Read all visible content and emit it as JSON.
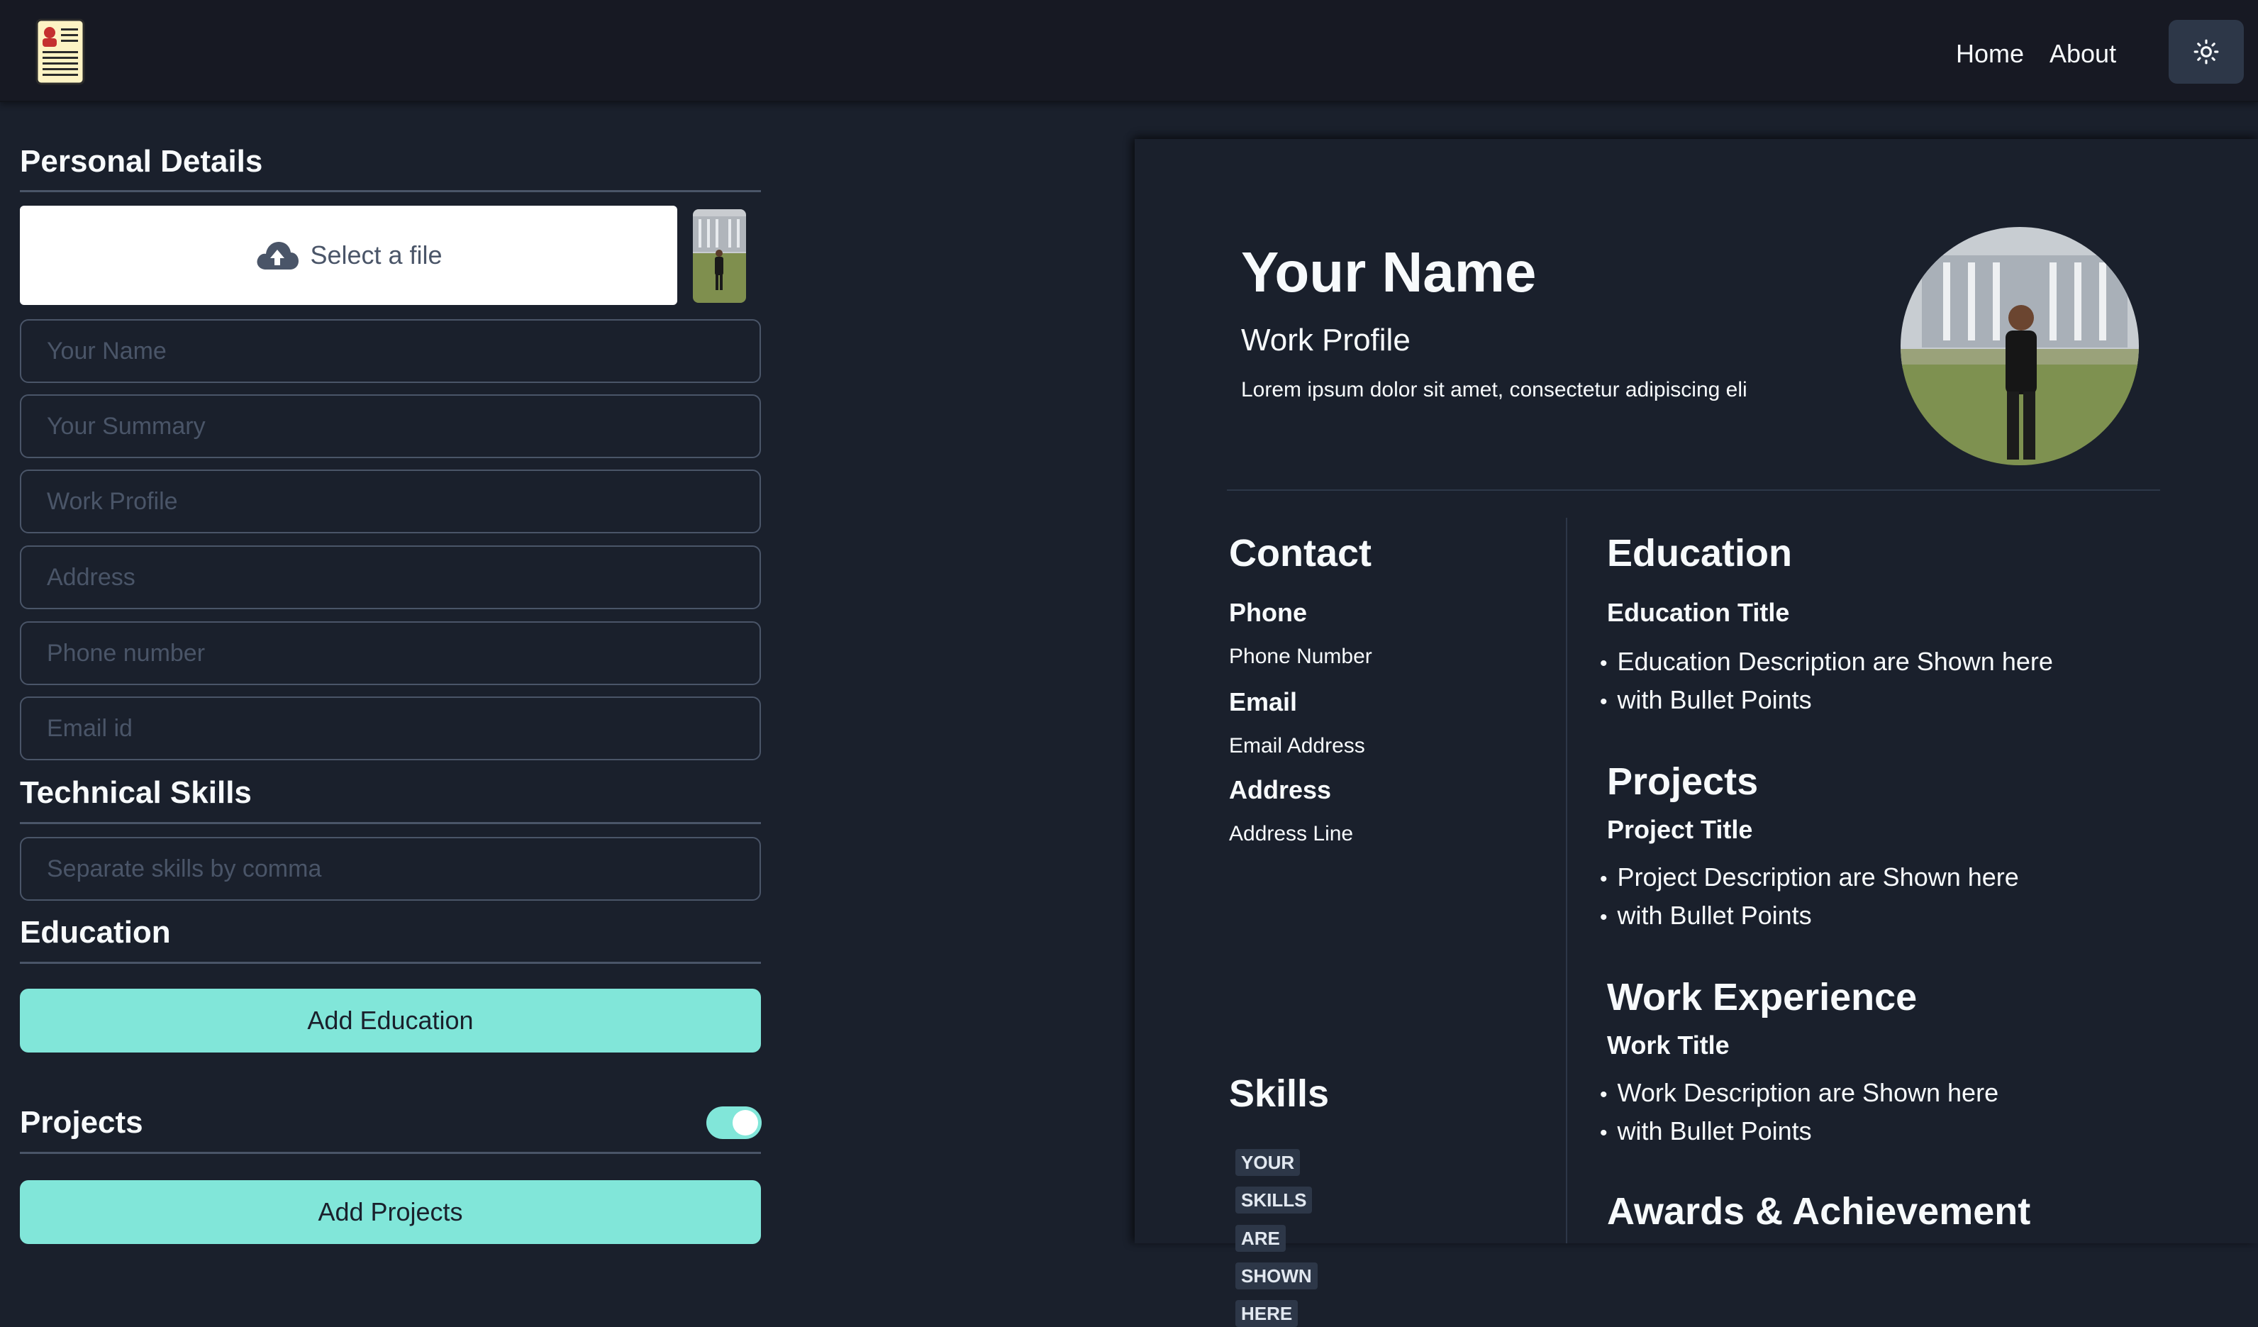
{
  "header": {
    "logo": "resume-icon",
    "nav": {
      "home": "Home",
      "about": "About"
    },
    "theme_icon": "sun-icon"
  },
  "form": {
    "personal": {
      "title": "Personal Details",
      "file_label": "Select a file",
      "placeholders": {
        "name": "Your Name",
        "summary": "Your Summary",
        "work_profile": "Work Profile",
        "address": "Address",
        "phone": "Phone number",
        "email": "Email id"
      }
    },
    "skills": {
      "title": "Technical Skills",
      "placeholder": "Separate skills by comma"
    },
    "education": {
      "title": "Education",
      "add_label": "Add Education"
    },
    "projects": {
      "title": "Projects",
      "add_label": "Add Projects",
      "toggle_on": true
    }
  },
  "preview": {
    "name": "Your Name",
    "work_profile": "Work Profile",
    "summary": "Lorem ipsum dolor sit amet, consectetur adipiscing eli",
    "contact": {
      "title": "Contact",
      "phone_label": "Phone",
      "phone_value": "Phone Number",
      "email_label": "Email",
      "email_value": "Email Address",
      "address_label": "Address",
      "address_value": "Address Line"
    },
    "skills": {
      "title": "Skills",
      "tags": [
        "YOUR",
        "SKILLS",
        "ARE",
        "SHOWN",
        "HERE"
      ]
    },
    "education": {
      "title": "Education",
      "item_title": "Education Title",
      "bullets": [
        "Education Description are Shown here",
        "with Bullet Points"
      ]
    },
    "projects": {
      "title": "Projects",
      "item_title": "Project Title",
      "bullets": [
        "Project Description are Shown here",
        "with Bullet Points"
      ]
    },
    "work": {
      "title": "Work Experience",
      "item_title": "Work Title",
      "bullets": [
        "Work Description are Shown here",
        "with Bullet Points"
      ]
    },
    "awards": {
      "title": "Awards & Achievement"
    }
  },
  "colors": {
    "background": "#1a202c",
    "header": "#171923",
    "accent": "#81e6d9",
    "border": "#4a5568",
    "tag_bg": "#2d3748"
  }
}
